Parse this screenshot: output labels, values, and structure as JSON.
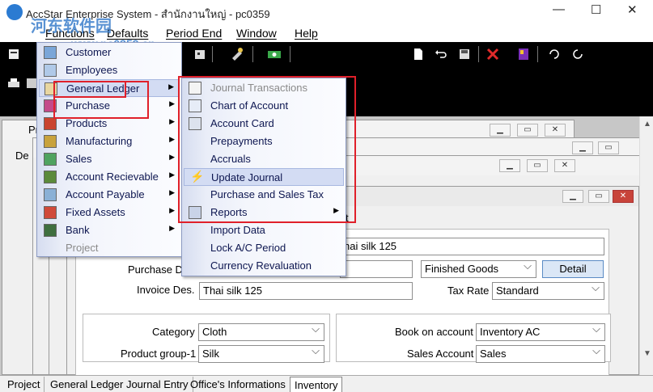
{
  "window": {
    "title": "AccStar Enterprise System - สำนักงานใหญ่ - pc0359",
    "minimize": "—",
    "maximize": "☐",
    "close": "✕"
  },
  "watermark": {
    "text": "河东软件园",
    "url": "www.pc0359.cn"
  },
  "menubar": [
    "Functions",
    "Defaults",
    "Period End",
    "Window",
    "Help"
  ],
  "menu_main": {
    "items": [
      {
        "label": "Customer",
        "icon": "customer-icon",
        "submenu": false,
        "disabled": false
      },
      {
        "label": "Employees",
        "icon": "employees-icon",
        "submenu": false,
        "disabled": false
      },
      {
        "label": "General Ledger",
        "icon": "ledger-icon",
        "submenu": true,
        "disabled": false
      },
      {
        "label": "Purchase",
        "icon": "purchase-icon",
        "submenu": true,
        "disabled": false
      },
      {
        "label": "Products",
        "icon": "products-icon",
        "submenu": true,
        "disabled": false
      },
      {
        "label": "Manufacturing",
        "icon": "manufacturing-icon",
        "submenu": true,
        "disabled": false
      },
      {
        "label": "Sales",
        "icon": "sales-icon",
        "submenu": true,
        "disabled": false
      },
      {
        "label": "Account Recievable",
        "icon": "receivable-icon",
        "submenu": true,
        "disabled": false
      },
      {
        "label": "Account Payable",
        "icon": "payable-icon",
        "submenu": true,
        "disabled": false
      },
      {
        "label": "Fixed Assets",
        "icon": "fixed-assets-icon",
        "submenu": true,
        "disabled": false
      },
      {
        "label": "Bank",
        "icon": "bank-icon",
        "submenu": true,
        "disabled": false
      },
      {
        "label": "Project",
        "icon": "",
        "submenu": false,
        "disabled": true
      }
    ]
  },
  "menu_gl": {
    "items": [
      {
        "label": "Journal Transactions",
        "submenu": false,
        "disabled": true
      },
      {
        "label": "Chart of Account",
        "submenu": false,
        "disabled": false
      },
      {
        "label": "Account Card",
        "submenu": false,
        "disabled": false
      },
      {
        "label": "Prepayments",
        "submenu": false,
        "disabled": false
      },
      {
        "label": "Accruals",
        "submenu": false,
        "disabled": false
      },
      {
        "label": "Update Journal",
        "submenu": false,
        "disabled": false
      },
      {
        "label": "Purchase and Sales Tax",
        "submenu": false,
        "disabled": false
      },
      {
        "label": "Reports",
        "submenu": true,
        "disabled": false
      },
      {
        "label": "Import Data",
        "submenu": false,
        "disabled": false
      },
      {
        "label": "Lock A/C Period",
        "submenu": false,
        "disabled": false
      },
      {
        "label": "Currency Revaluation",
        "submenu": false,
        "disabled": false
      }
    ]
  },
  "behind": {
    "pr": "Pr",
    "de": "De",
    "tab_t": "t"
  },
  "form": {
    "name_value": "hai silk 125",
    "purchase_desc_label": "Purchase De",
    "purchase_desc_value": "",
    "goods_type": "Finished Goods",
    "detail_button": "Detail",
    "invoice_desc_label": "Invoice Des.",
    "invoice_desc_value": "Thai silk 125",
    "tax_rate_label": "Tax Rate",
    "tax_rate_value": "Standard",
    "category_label": "Category",
    "category_value": "Cloth",
    "product_group_label": "Product group-1",
    "product_group_value": "Silk",
    "book_on_account_label": "Book on account",
    "book_on_account_value": "Inventory AC",
    "sales_account_label": "Sales Account",
    "sales_account_value": "Sales"
  },
  "bottom_tabs": [
    "Project",
    "General Ledger Journal Entry",
    "Office's Informations",
    "Inventory"
  ],
  "colors": {
    "highlight_box": "#e0202a",
    "toolbar_bg": "#000000",
    "menu_text": "#0d1650"
  }
}
